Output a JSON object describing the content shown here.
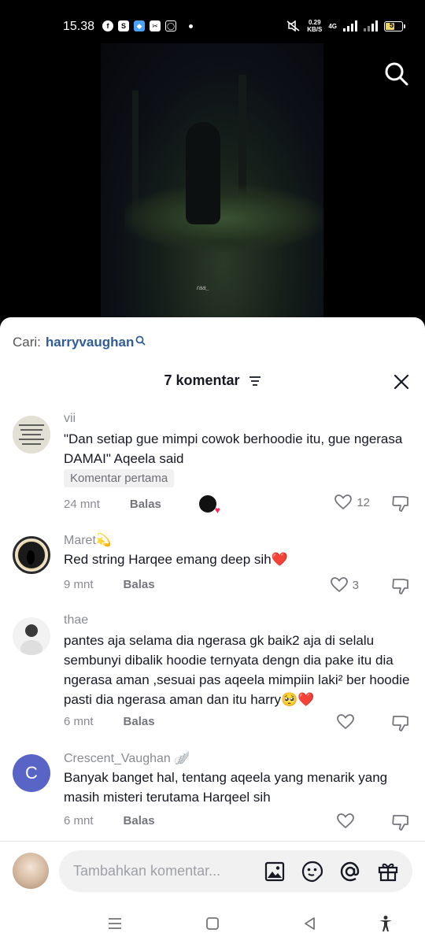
{
  "status_bar": {
    "time": "15.38",
    "app_icons": [
      "facebook-icon",
      "shopping-bag-icon",
      "blue-app-icon",
      "capcut-icon",
      "instagram-icon"
    ],
    "speed_value": "0.29",
    "speed_unit": "KB/S",
    "network": "4G",
    "battery": "57",
    "battery_level": 0.57
  },
  "video": {
    "watermark": "raa_"
  },
  "search": {
    "prefix": "Cari:",
    "term": "harryvaughan"
  },
  "sheet": {
    "title": "7 komentar"
  },
  "comments": [
    {
      "user": "vii",
      "text": "\"Dan setiap gue mimpi cowok berhoodie itu, gue ngerasa DAMAI\" Aqeela said",
      "tag": "Komentar pertama",
      "time": "24 mnt",
      "reply": "Balas",
      "likes": "12",
      "creator_liked": true
    },
    {
      "user": "Maret💫",
      "text": "Red string Harqee emang deep sih❤️",
      "time": "9 mnt",
      "reply": "Balas",
      "likes": "3"
    },
    {
      "user": "thae",
      "text": "pantes aja selama dia ngerasa gk baik2 aja di selalu sembunyi dibalik hoodie ternyata dengn dia pake itu dia ngerasa aman ,sesuai pas aqeela mimpiin laki² ber hoodie pasti dia ngerasa aman dan itu harry🥺❤️",
      "time": "6 mnt",
      "reply": "Balas",
      "likes": ""
    },
    {
      "user": "Crescent_Vaughan 🪽",
      "avatar_letter": "C",
      "text": "Banyak banget hal, tentang aqeela yang menarik yang masih misteri terutama Harqeel sih",
      "time": "6 mnt",
      "reply": "Balas",
      "likes": ""
    }
  ],
  "composer": {
    "placeholder": "Tambahkan komentar...",
    "icons": [
      "image-icon",
      "emoji-sticker-icon",
      "mention-icon",
      "gift-icon"
    ]
  },
  "colors": {
    "link_blue": "#2f5c9a",
    "avatar_c": "#5865c7",
    "heart_red": "#fe2c55"
  }
}
